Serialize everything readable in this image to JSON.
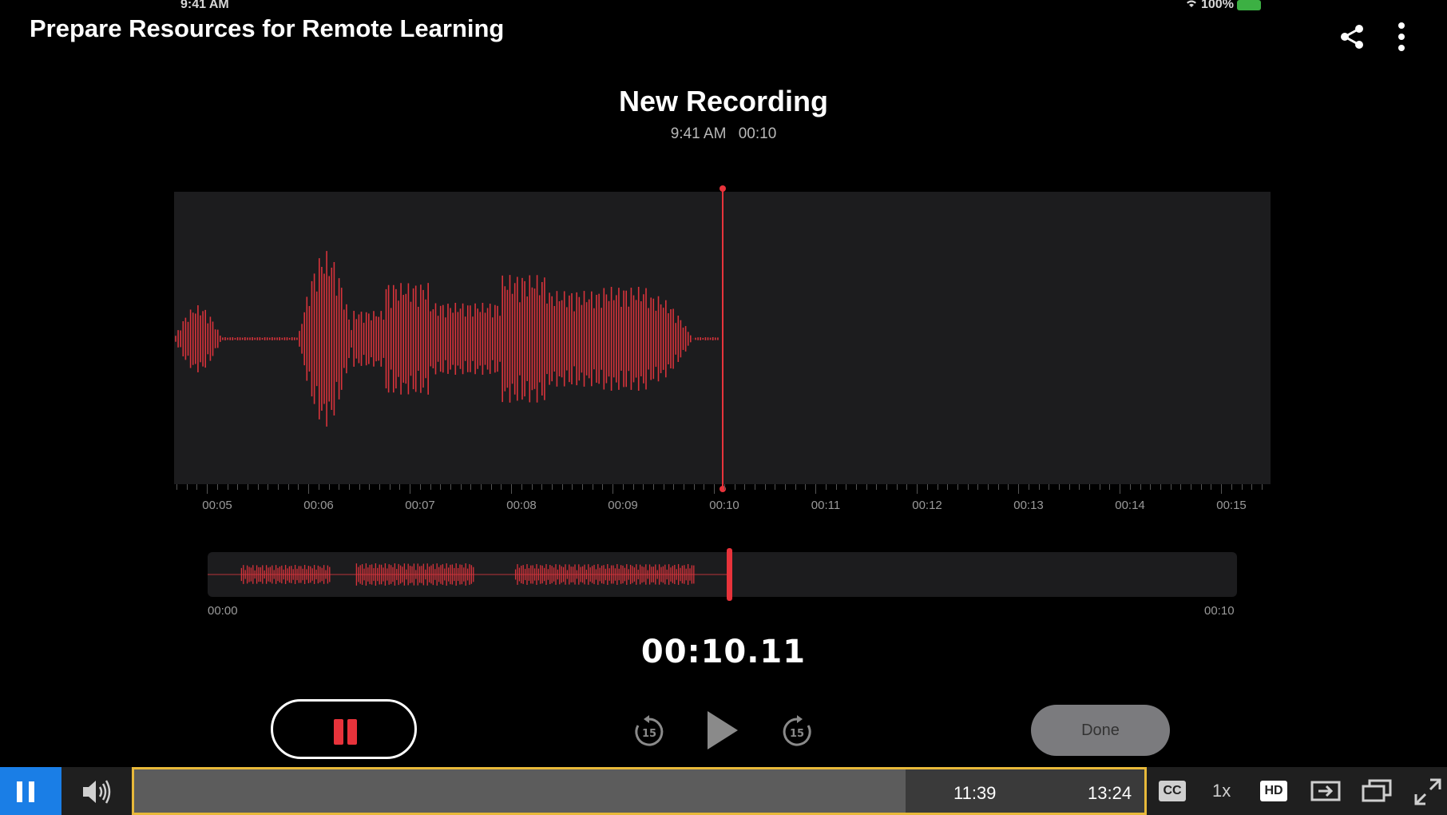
{
  "status_bar": {
    "time": "9:41 AM",
    "battery": "100%"
  },
  "video": {
    "title": "Prepare Resources for Remote Learning"
  },
  "recording": {
    "title": "New Recording",
    "time": "9:41 AM",
    "duration": "00:10",
    "ruler_labels": [
      "00:05",
      "00:06",
      "00:07",
      "00:08",
      "00:09",
      "00:10",
      "00:11",
      "00:12",
      "00:13",
      "00:14",
      "00:15"
    ],
    "overview_start": "00:00",
    "overview_end": "00:10",
    "timer": "00:10.11",
    "skip_back": "15",
    "skip_forward": "15",
    "done_label": "Done"
  },
  "player": {
    "current_time": "11:39",
    "duration": "13:24",
    "progress_fraction": 0.764,
    "cc_label": "CC",
    "speed_label": "1x",
    "hd_label": "HD"
  },
  "colors": {
    "accent": "#e8333b",
    "player_accent": "#1a7ee6",
    "focus_border": "#e8b93a"
  }
}
